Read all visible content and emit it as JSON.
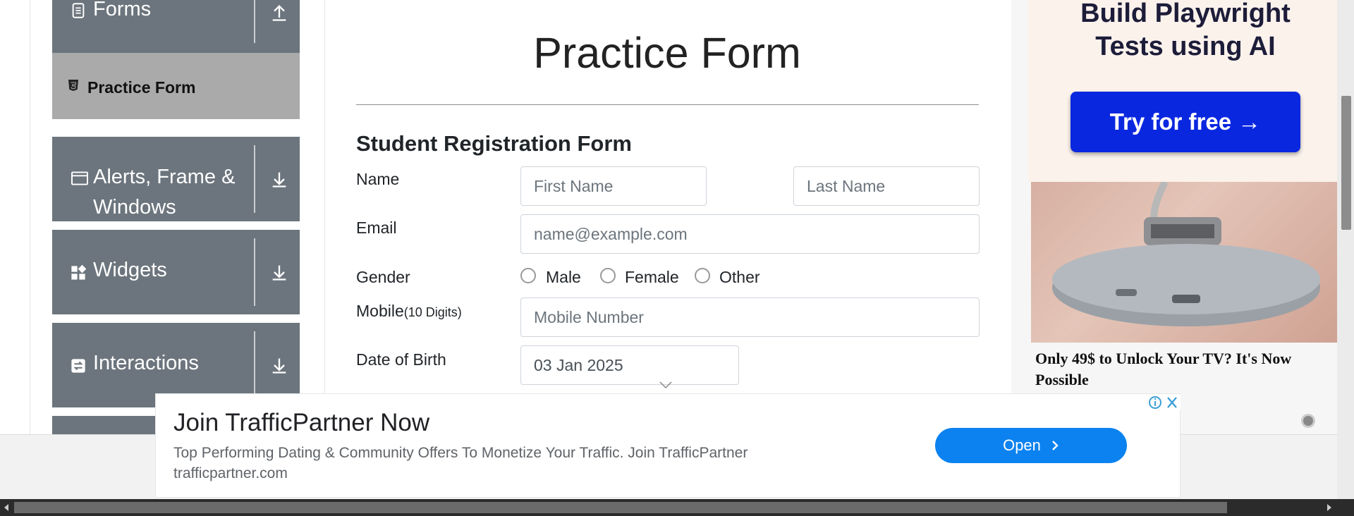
{
  "sidebar": {
    "forms_label": "Forms",
    "active_item": "Practice Form",
    "alerts_label_line1": "Alerts, Frame &",
    "alerts_label_line2": "Windows",
    "widgets_label": "Widgets",
    "interactions_label": "Interactions"
  },
  "main": {
    "page_title": "Practice Form",
    "form_title": "Student Registration Form",
    "name_label": "Name",
    "first_name_placeholder": "First Name",
    "last_name_placeholder": "Last Name",
    "email_label": "Email",
    "email_placeholder": "name@example.com",
    "gender_label": "Gender",
    "gender_options": [
      "Male",
      "Female",
      "Other"
    ],
    "mobile_label": "Mobile",
    "mobile_hint": "(10 Digits)",
    "mobile_placeholder": "Mobile Number",
    "dob_label": "Date of Birth",
    "dob_value": "03 Jan 2025"
  },
  "right_ad": {
    "headline_line1": "Build Playwright",
    "headline_line2": "Tests using AI",
    "button_label": "Try for free →",
    "caption": "Only 49$ to Unlock Your TV? It's Now Possible"
  },
  "bottom_ad": {
    "title": "Join TrafficPartner Now",
    "description": "Top Performing Dating & Community Offers To Monetize Your Traffic. Join TrafficPartner",
    "domain": "trafficpartner.com",
    "open_label": "Open"
  },
  "colors": {
    "sidebar_bg": "#6c757d",
    "active_bg": "#aaaaaa",
    "ad_button": "#0a27e0",
    "open_button": "#0b82f0"
  }
}
